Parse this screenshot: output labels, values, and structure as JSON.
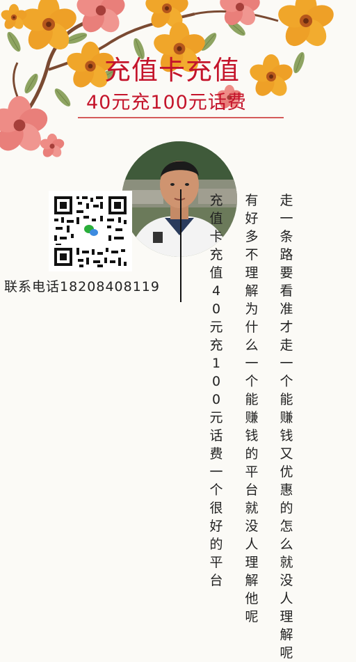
{
  "header": {
    "title": "充值卡充值",
    "subtitle": "40元充100元话费"
  },
  "contact": {
    "phone_text": "联系电话18208408119"
  },
  "columns": [
    "走一条路要看准才走一个能赚钱又优惠的怎么就没人理解呢",
    "有好多不理解为什么一个能赚钱的平台就没人理解他呢",
    "充值卡充值40元充100元话费一个很好的平台"
  ],
  "colors": {
    "accent": "#c4142b",
    "background": "#fbfaf6"
  },
  "icons": {
    "qr": "wechat-qr-code",
    "avatar": "profile-photo"
  }
}
